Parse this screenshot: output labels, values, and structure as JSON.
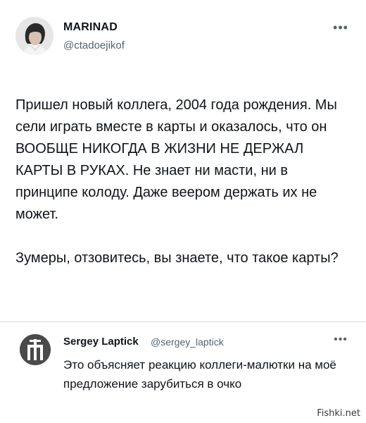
{
  "post": {
    "author_name": "MARINAD",
    "author_handle": "@ctadoejikof",
    "more_glyph": "•••",
    "paragraphs": [
      "Пришел новый коллега, 2004 года рождения. Мы сели играть вместе в карты и оказалось, что он ВООБЩЕ НИКОГДА В ЖИЗНИ НЕ ДЕРЖАЛ КАРТЫ В РУКАХ. Не знает ни масти, ни в принципе колоду. Даже веером держать их не может.",
      "Зумеры, отзовитесь, вы знаете, что такое карты?"
    ]
  },
  "reply": {
    "author_name": "Sergey Laptick",
    "author_handle": "@sergey_laptick",
    "more_glyph": "•••",
    "text": "Это объясняет реакцию коллеги-малютки на моё предложение зарубиться в очко"
  },
  "watermark": "Fishki.net",
  "colors": {
    "text": "#0f1419",
    "secondary": "#536471",
    "divider": "#d6dbdf",
    "background": "#ffffff"
  }
}
